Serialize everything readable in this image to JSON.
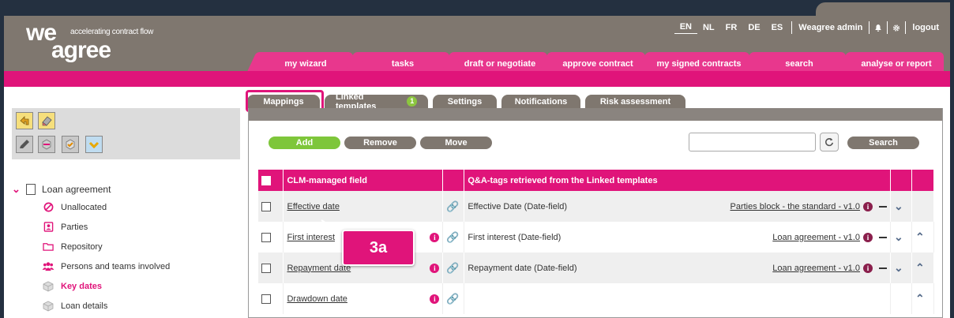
{
  "logo": {
    "line1": "we",
    "line2": "agree",
    "tagline": "accelerating contract flow"
  },
  "topnav": {
    "languages": [
      "EN",
      "NL",
      "FR",
      "DE",
      "ES"
    ],
    "active_language": "EN",
    "user": "Weagree admin",
    "logout": "logout"
  },
  "mainnav": [
    "my wizard",
    "tasks",
    "draft or negotiate",
    "approve contract",
    "my signed contracts",
    "search",
    "analyse or report"
  ],
  "sidebar": {
    "root": "Loan agreement",
    "items": [
      {
        "label": "Unallocated",
        "icon": "ban-icon"
      },
      {
        "label": "Parties",
        "icon": "contact-card-icon"
      },
      {
        "label": "Repository",
        "icon": "folder-icon"
      },
      {
        "label": "Persons and teams involved",
        "icon": "people-icon"
      },
      {
        "label": "Key dates",
        "icon": "cube-icon"
      },
      {
        "label": "Loan details",
        "icon": "cube-icon"
      }
    ]
  },
  "subtabs": {
    "mappings": "Mappings",
    "linked": "Linked templates",
    "linked_badge": "1",
    "settings": "Settings",
    "notifications": "Notifications",
    "risk": "Risk assessment"
  },
  "actions": {
    "add": "Add",
    "remove": "Remove",
    "move": "Move",
    "search": "Search"
  },
  "table": {
    "header_field": "CLM-managed field",
    "header_tags": "Q&A-tags retrieved from the Linked templates",
    "rows": [
      {
        "field": "Effective date",
        "tag": "Effective Date (Date-field)",
        "template": "Parties block - the standard - v1.0"
      },
      {
        "field": "First interest",
        "tag": "First interest (Date-field)",
        "template": "Loan agreement - v1.0"
      },
      {
        "field": "Repayment date",
        "tag": "Repayment date (Date-field)",
        "template": "Loan agreement - v1.0"
      },
      {
        "field": "Drawdown date",
        "tag": "",
        "template": ""
      }
    ]
  },
  "callout": "3a",
  "colors": {
    "brand_pink": "#e0147a",
    "frame_gray": "#7f776f",
    "add_green": "#7ec63a"
  }
}
